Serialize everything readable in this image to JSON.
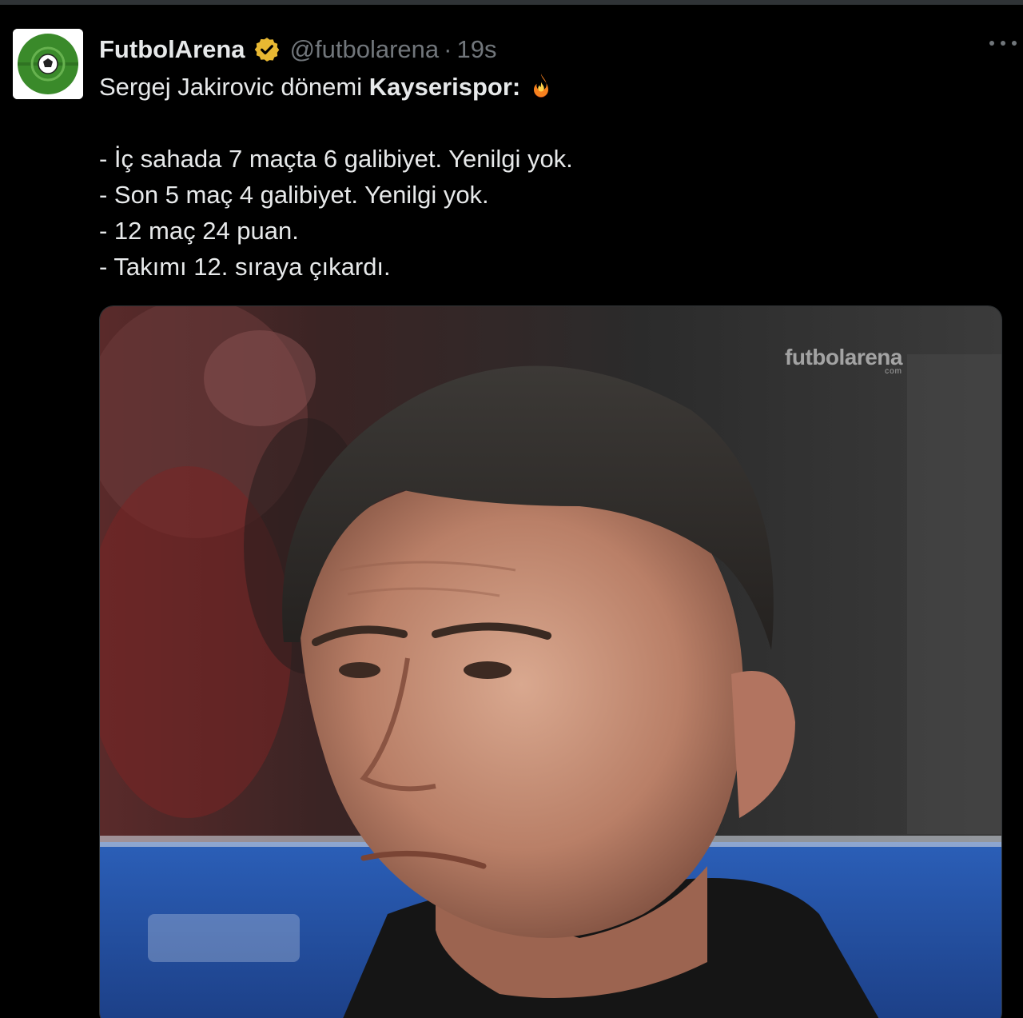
{
  "tweet": {
    "display_name": "FutbolArena",
    "handle": "@futbolarena",
    "separator": "·",
    "time": "19s",
    "verified_icon": "verified-badge-icon",
    "more_icon": "more-dots-icon",
    "intro_plain": "Sergej Jakirovic dönemi ",
    "intro_bold": "Kayserispor:",
    "intro_emoji": "fire-icon",
    "lines": [
      "- İç sahada 7 maçta 6 galibiyet. Yenilgi yok.",
      "- Son 5 maç 4 galibiyet. Yenilgi yok.",
      "- 12 maç 24 puan.",
      "- Takımı 12. sıraya çıkardı."
    ]
  },
  "media": {
    "watermark_main": "futbolarena",
    "watermark_sub": "com"
  },
  "colors": {
    "background": "#000000",
    "text": "#e7e9ea",
    "muted": "#71767b",
    "verified": "#e8b832",
    "avatar_green": "#3a8a2a"
  }
}
